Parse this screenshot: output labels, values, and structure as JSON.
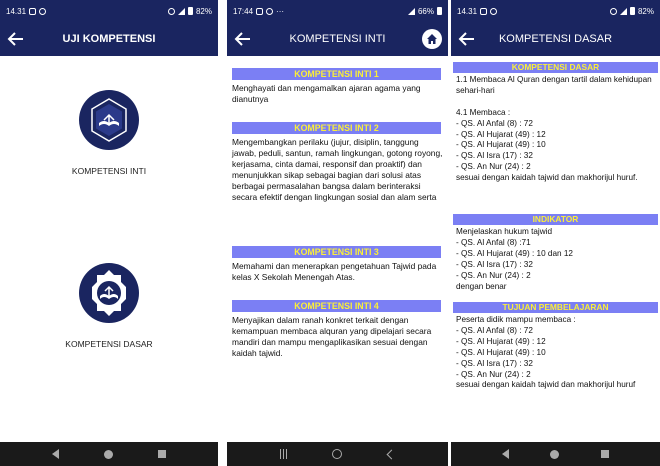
{
  "screen1": {
    "status": {
      "time": "14.31",
      "battery": "82%"
    },
    "title": "UJI KOMPETENSI",
    "menu": [
      {
        "label": "KOMPETENSI INTI",
        "icon": "quran-emblem-icon"
      },
      {
        "label": "KOMPETENSI DASAR",
        "icon": "quran-emblem-icon"
      }
    ]
  },
  "screen2": {
    "status": {
      "time": "17:44",
      "battery": "66%"
    },
    "title": "KOMPETENSI INTI",
    "sections": [
      {
        "heading": "KOMPETENSI INTI 1",
        "body": "Menghayati dan mengamalkan ajaran agama yang dianutnya"
      },
      {
        "heading": "KOMPETENSI INTI 2",
        "body": "Mengembangkan perilaku (jujur, disiplin, tanggung jawab, peduli, santun, ramah lingkungan, gotong royong, kerjasama, cinta damai, responsif dan proaktif) dan menunjukkan sikap sebagai bagian dari solusi atas berbagai permasalahan bangsa dalam berinteraksi secara efektif dengan lingkungan sosial dan alam serta"
      },
      {
        "heading": "KOMPETENSI INTI 3",
        "body": "Memahami dan menerapkan pengetahuan Tajwid pada kelas X Sekolah Menengah Atas."
      },
      {
        "heading": "KOMPETENSI INTI 4",
        "body": "Menyajikan dalam ranah konkret terkait dengan kemampuan membaca alquran yang dipelajari secara mandiri dan mampu mengaplikasikan sesuai dengan kaidah tajwid."
      }
    ]
  },
  "screen3": {
    "status": {
      "time": "14.31",
      "battery": "82%"
    },
    "title": "KOMPETENSI DASAR",
    "sections": [
      {
        "heading": "KOMPETENSI DASAR",
        "body": "1.1 Membaca Al Quran dengan tartil dalam kehidupan sehari-hari\n\n4.1 Membaca :\n- QS. Al Anfal (8) : 72\n- QS. Al Hujarat (49) : 12\n- QS. Al Hujarat (49) : 10\n- QS. Al Isra (17) : 32\n- QS. An Nur (24) : 2\nsesuai dengan kaidah tajwid dan makhorijul huruf."
      },
      {
        "heading": "INDIKATOR",
        "body": "Menjelaskan hukum tajwid\n- QS. Al Anfal (8) :71\n- QS. Al Hujarat (49) : 10 dan 12\n- QS. Al Isra (17) : 32\n- QS. An Nur (24) : 2\ndengan benar"
      },
      {
        "heading": "TUJUAN PEMBELAJARAN",
        "body": "Peserta didik mampu membaca :\n- QS. Al Anfal (8) : 72\n- QS. Al Hujarat (49) : 12\n- QS. Al Hujarat (49) : 10\n- QS. Al Isra (17) : 32\n- QS. An Nur (24) : 2\nsesuai dengan kaidah tajwid dan makhorijul huruf"
      }
    ]
  },
  "colors": {
    "appbar": "#1a2560",
    "section_bg": "#7b7ff4",
    "section_text": "#fbef38",
    "emblem": "#1a2560"
  }
}
